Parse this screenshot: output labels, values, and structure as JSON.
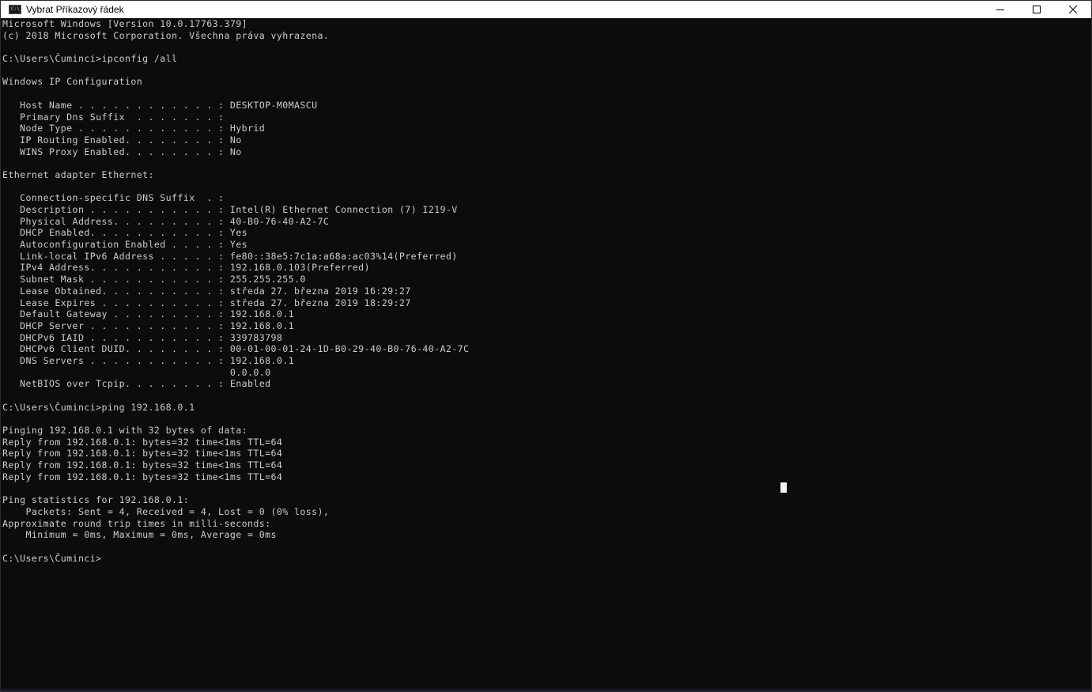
{
  "window": {
    "title": "Vybrat Příkazový řádek",
    "icon": "cmd-icon",
    "icon_text": "C:\\"
  },
  "controls": {
    "minimize": "minimize-icon",
    "maximize": "maximize-icon",
    "close": "close-icon"
  },
  "console": {
    "lines": [
      "Microsoft Windows [Version 10.0.17763.379]",
      "(c) 2018 Microsoft Corporation. Všechna práva vyhrazena.",
      "",
      "C:\\Users\\Čuminci>ipconfig /all",
      "",
      "Windows IP Configuration",
      "",
      "   Host Name . . . . . . . . . . . . : DESKTOP-M0MASCU",
      "   Primary Dns Suffix  . . . . . . . :",
      "   Node Type . . . . . . . . . . . . : Hybrid",
      "   IP Routing Enabled. . . . . . . . : No",
      "   WINS Proxy Enabled. . . . . . . . : No",
      "",
      "Ethernet adapter Ethernet:",
      "",
      "   Connection-specific DNS Suffix  . :",
      "   Description . . . . . . . . . . . : Intel(R) Ethernet Connection (7) I219-V",
      "   Physical Address. . . . . . . . . : 40-B0-76-40-A2-7C",
      "   DHCP Enabled. . . . . . . . . . . : Yes",
      "   Autoconfiguration Enabled . . . . : Yes",
      "   Link-local IPv6 Address . . . . . : fe80::38e5:7c1a:a68a:ac03%14(Preferred)",
      "   IPv4 Address. . . . . . . . . . . : 192.168.0.103(Preferred)",
      "   Subnet Mask . . . . . . . . . . . : 255.255.255.0",
      "   Lease Obtained. . . . . . . . . . : středa 27. března 2019 16:29:27",
      "   Lease Expires . . . . . . . . . . : středa 27. března 2019 18:29:27",
      "   Default Gateway . . . . . . . . . : 192.168.0.1",
      "   DHCP Server . . . . . . . . . . . : 192.168.0.1",
      "   DHCPv6 IAID . . . . . . . . . . . : 339783798",
      "   DHCPv6 Client DUID. . . . . . . . : 00-01-00-01-24-1D-B0-29-40-B0-76-40-A2-7C",
      "   DNS Servers . . . . . . . . . . . : 192.168.0.1",
      "                                       0.0.0.0",
      "   NetBIOS over Tcpip. . . . . . . . : Enabled",
      "",
      "C:\\Users\\Čuminci>ping 192.168.0.1",
      "",
      "Pinging 192.168.0.1 with 32 bytes of data:",
      "Reply from 192.168.0.1: bytes=32 time<1ms TTL=64",
      "Reply from 192.168.0.1: bytes=32 time<1ms TTL=64",
      "Reply from 192.168.0.1: bytes=32 time<1ms TTL=64",
      "Reply from 192.168.0.1: bytes=32 time<1ms TTL=64",
      "",
      "Ping statistics for 192.168.0.1:",
      "    Packets: Sent = 4, Received = 4, Lost = 0 (0% loss),",
      "Approximate round trip times in milli-seconds:",
      "    Minimum = 0ms, Maximum = 0ms, Average = 0ms",
      "",
      "C:\\Users\\Čuminci>"
    ]
  },
  "colors": {
    "background": "#0c0c0c",
    "text": "#cccccc",
    "titlebar": "#ffffff"
  }
}
